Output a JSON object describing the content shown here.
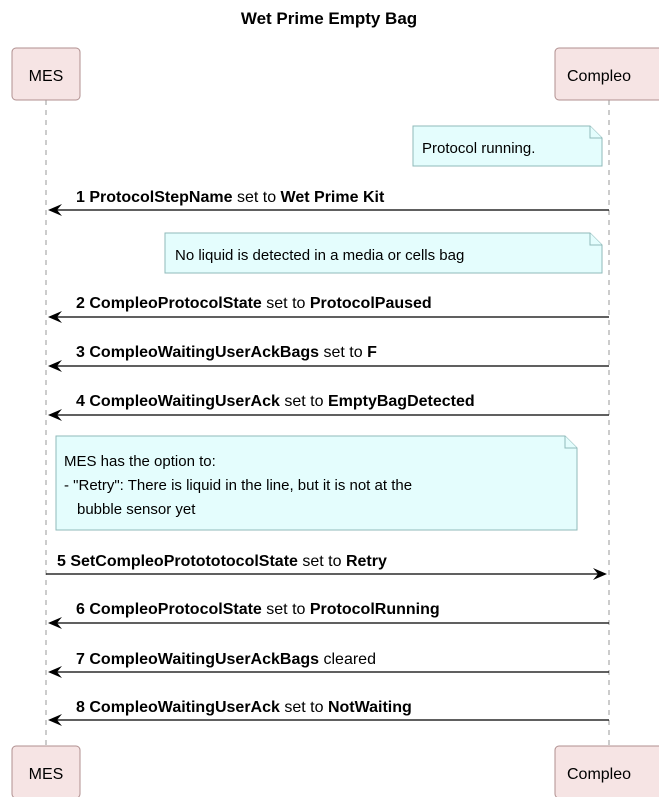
{
  "title": "Wet Prime Empty Bag",
  "participants": {
    "mes": "MES",
    "compleo": "Compleo"
  },
  "notes": {
    "n1": "Protocol running.",
    "n2": "No liquid is detected in a media or cells bag",
    "n3": {
      "line1": "MES has the option to:",
      "line2": "- \"Retry\": There is liquid in the line, but it is not at the",
      "line3": "bubble sensor yet"
    }
  },
  "messages": [
    {
      "num": "1",
      "name": "ProtocolStepName",
      "verb": "set to",
      "value": "Wet Prime Kit"
    },
    {
      "num": "2",
      "name": "CompleoProtocolState",
      "verb": "set to",
      "value": "ProtocolPaused"
    },
    {
      "num": "3",
      "name": "CompleoWaitingUserAckBags",
      "verb": "set to",
      "value": "F"
    },
    {
      "num": "4",
      "name": "CompleoWaitingUserAck",
      "verb": "set to",
      "value": "EmptyBagDetected"
    },
    {
      "num": "5",
      "name": "SetCompleoProtototocolState",
      "verb": "set to",
      "value": "Retry"
    },
    {
      "num": "6",
      "name": "CompleoProtocolState",
      "verb": "set to",
      "value": "ProtocolRunning"
    },
    {
      "num": "7",
      "name": "CompleoWaitingUserAckBags",
      "verb": "cleared",
      "value": ""
    },
    {
      "num": "8",
      "name": "CompleoWaitingUserAck",
      "verb": "set to",
      "value": "NotWaiting"
    }
  ]
}
